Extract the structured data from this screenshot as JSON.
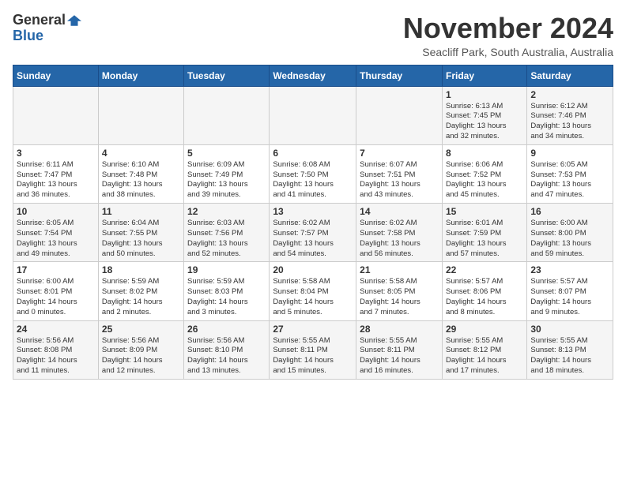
{
  "header": {
    "logo_general": "General",
    "logo_blue": "Blue",
    "month": "November 2024",
    "location": "Seacliff Park, South Australia, Australia"
  },
  "weekdays": [
    "Sunday",
    "Monday",
    "Tuesday",
    "Wednesday",
    "Thursday",
    "Friday",
    "Saturday"
  ],
  "weeks": [
    [
      {
        "day": "",
        "info": ""
      },
      {
        "day": "",
        "info": ""
      },
      {
        "day": "",
        "info": ""
      },
      {
        "day": "",
        "info": ""
      },
      {
        "day": "",
        "info": ""
      },
      {
        "day": "1",
        "info": "Sunrise: 6:13 AM\nSunset: 7:45 PM\nDaylight: 13 hours\nand 32 minutes."
      },
      {
        "day": "2",
        "info": "Sunrise: 6:12 AM\nSunset: 7:46 PM\nDaylight: 13 hours\nand 34 minutes."
      }
    ],
    [
      {
        "day": "3",
        "info": "Sunrise: 6:11 AM\nSunset: 7:47 PM\nDaylight: 13 hours\nand 36 minutes."
      },
      {
        "day": "4",
        "info": "Sunrise: 6:10 AM\nSunset: 7:48 PM\nDaylight: 13 hours\nand 38 minutes."
      },
      {
        "day": "5",
        "info": "Sunrise: 6:09 AM\nSunset: 7:49 PM\nDaylight: 13 hours\nand 39 minutes."
      },
      {
        "day": "6",
        "info": "Sunrise: 6:08 AM\nSunset: 7:50 PM\nDaylight: 13 hours\nand 41 minutes."
      },
      {
        "day": "7",
        "info": "Sunrise: 6:07 AM\nSunset: 7:51 PM\nDaylight: 13 hours\nand 43 minutes."
      },
      {
        "day": "8",
        "info": "Sunrise: 6:06 AM\nSunset: 7:52 PM\nDaylight: 13 hours\nand 45 minutes."
      },
      {
        "day": "9",
        "info": "Sunrise: 6:05 AM\nSunset: 7:53 PM\nDaylight: 13 hours\nand 47 minutes."
      }
    ],
    [
      {
        "day": "10",
        "info": "Sunrise: 6:05 AM\nSunset: 7:54 PM\nDaylight: 13 hours\nand 49 minutes."
      },
      {
        "day": "11",
        "info": "Sunrise: 6:04 AM\nSunset: 7:55 PM\nDaylight: 13 hours\nand 50 minutes."
      },
      {
        "day": "12",
        "info": "Sunrise: 6:03 AM\nSunset: 7:56 PM\nDaylight: 13 hours\nand 52 minutes."
      },
      {
        "day": "13",
        "info": "Sunrise: 6:02 AM\nSunset: 7:57 PM\nDaylight: 13 hours\nand 54 minutes."
      },
      {
        "day": "14",
        "info": "Sunrise: 6:02 AM\nSunset: 7:58 PM\nDaylight: 13 hours\nand 56 minutes."
      },
      {
        "day": "15",
        "info": "Sunrise: 6:01 AM\nSunset: 7:59 PM\nDaylight: 13 hours\nand 57 minutes."
      },
      {
        "day": "16",
        "info": "Sunrise: 6:00 AM\nSunset: 8:00 PM\nDaylight: 13 hours\nand 59 minutes."
      }
    ],
    [
      {
        "day": "17",
        "info": "Sunrise: 6:00 AM\nSunset: 8:01 PM\nDaylight: 14 hours\nand 0 minutes."
      },
      {
        "day": "18",
        "info": "Sunrise: 5:59 AM\nSunset: 8:02 PM\nDaylight: 14 hours\nand 2 minutes."
      },
      {
        "day": "19",
        "info": "Sunrise: 5:59 AM\nSunset: 8:03 PM\nDaylight: 14 hours\nand 3 minutes."
      },
      {
        "day": "20",
        "info": "Sunrise: 5:58 AM\nSunset: 8:04 PM\nDaylight: 14 hours\nand 5 minutes."
      },
      {
        "day": "21",
        "info": "Sunrise: 5:58 AM\nSunset: 8:05 PM\nDaylight: 14 hours\nand 7 minutes."
      },
      {
        "day": "22",
        "info": "Sunrise: 5:57 AM\nSunset: 8:06 PM\nDaylight: 14 hours\nand 8 minutes."
      },
      {
        "day": "23",
        "info": "Sunrise: 5:57 AM\nSunset: 8:07 PM\nDaylight: 14 hours\nand 9 minutes."
      }
    ],
    [
      {
        "day": "24",
        "info": "Sunrise: 5:56 AM\nSunset: 8:08 PM\nDaylight: 14 hours\nand 11 minutes."
      },
      {
        "day": "25",
        "info": "Sunrise: 5:56 AM\nSunset: 8:09 PM\nDaylight: 14 hours\nand 12 minutes."
      },
      {
        "day": "26",
        "info": "Sunrise: 5:56 AM\nSunset: 8:10 PM\nDaylight: 14 hours\nand 13 minutes."
      },
      {
        "day": "27",
        "info": "Sunrise: 5:55 AM\nSunset: 8:11 PM\nDaylight: 14 hours\nand 15 minutes."
      },
      {
        "day": "28",
        "info": "Sunrise: 5:55 AM\nSunset: 8:11 PM\nDaylight: 14 hours\nand 16 minutes."
      },
      {
        "day": "29",
        "info": "Sunrise: 5:55 AM\nSunset: 8:12 PM\nDaylight: 14 hours\nand 17 minutes."
      },
      {
        "day": "30",
        "info": "Sunrise: 5:55 AM\nSunset: 8:13 PM\nDaylight: 14 hours\nand 18 minutes."
      }
    ]
  ]
}
